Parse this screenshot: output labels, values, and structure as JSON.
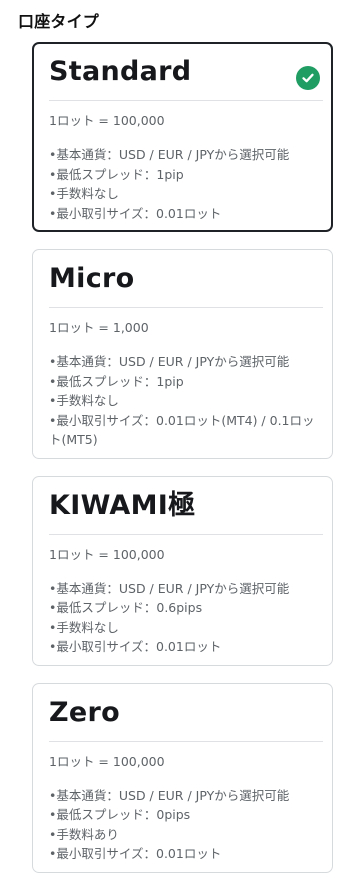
{
  "section_title": "口座タイプ",
  "accent_color": "#1f9d63",
  "cards": [
    {
      "name": "Standard",
      "selected": true,
      "lot": "1ロット = 100,000",
      "features": [
        "•基本通貨：USD / EUR / JPYから選択可能",
        "•最低スプレッド：1pip",
        "•手数料なし",
        "•最小取引サイズ：0.01ロット"
      ]
    },
    {
      "name": "Micro",
      "selected": false,
      "lot": "1ロット = 1,000",
      "features": [
        "•基本通貨：USD / EUR / JPYから選択可能",
        "•最低スプレッド：1pip",
        "•手数料なし",
        "•最小取引サイズ：0.01ロット(MT4) / 0.1ロット(MT5)"
      ]
    },
    {
      "name": "KIWAMI極",
      "selected": false,
      "lot": "1ロット = 100,000",
      "features": [
        "•基本通貨：USD / EUR / JPYから選択可能",
        "•最低スプレッド：0.6pips",
        "•手数料なし",
        "•最小取引サイズ：0.01ロット"
      ]
    },
    {
      "name": "Zero",
      "selected": false,
      "lot": "1ロット = 100,000",
      "features": [
        "•基本通貨：USD / EUR / JPYから選択可能",
        "•最低スプレッド：0pips",
        "•手数料あり",
        "•最小取引サイズ：0.01ロット"
      ]
    }
  ]
}
